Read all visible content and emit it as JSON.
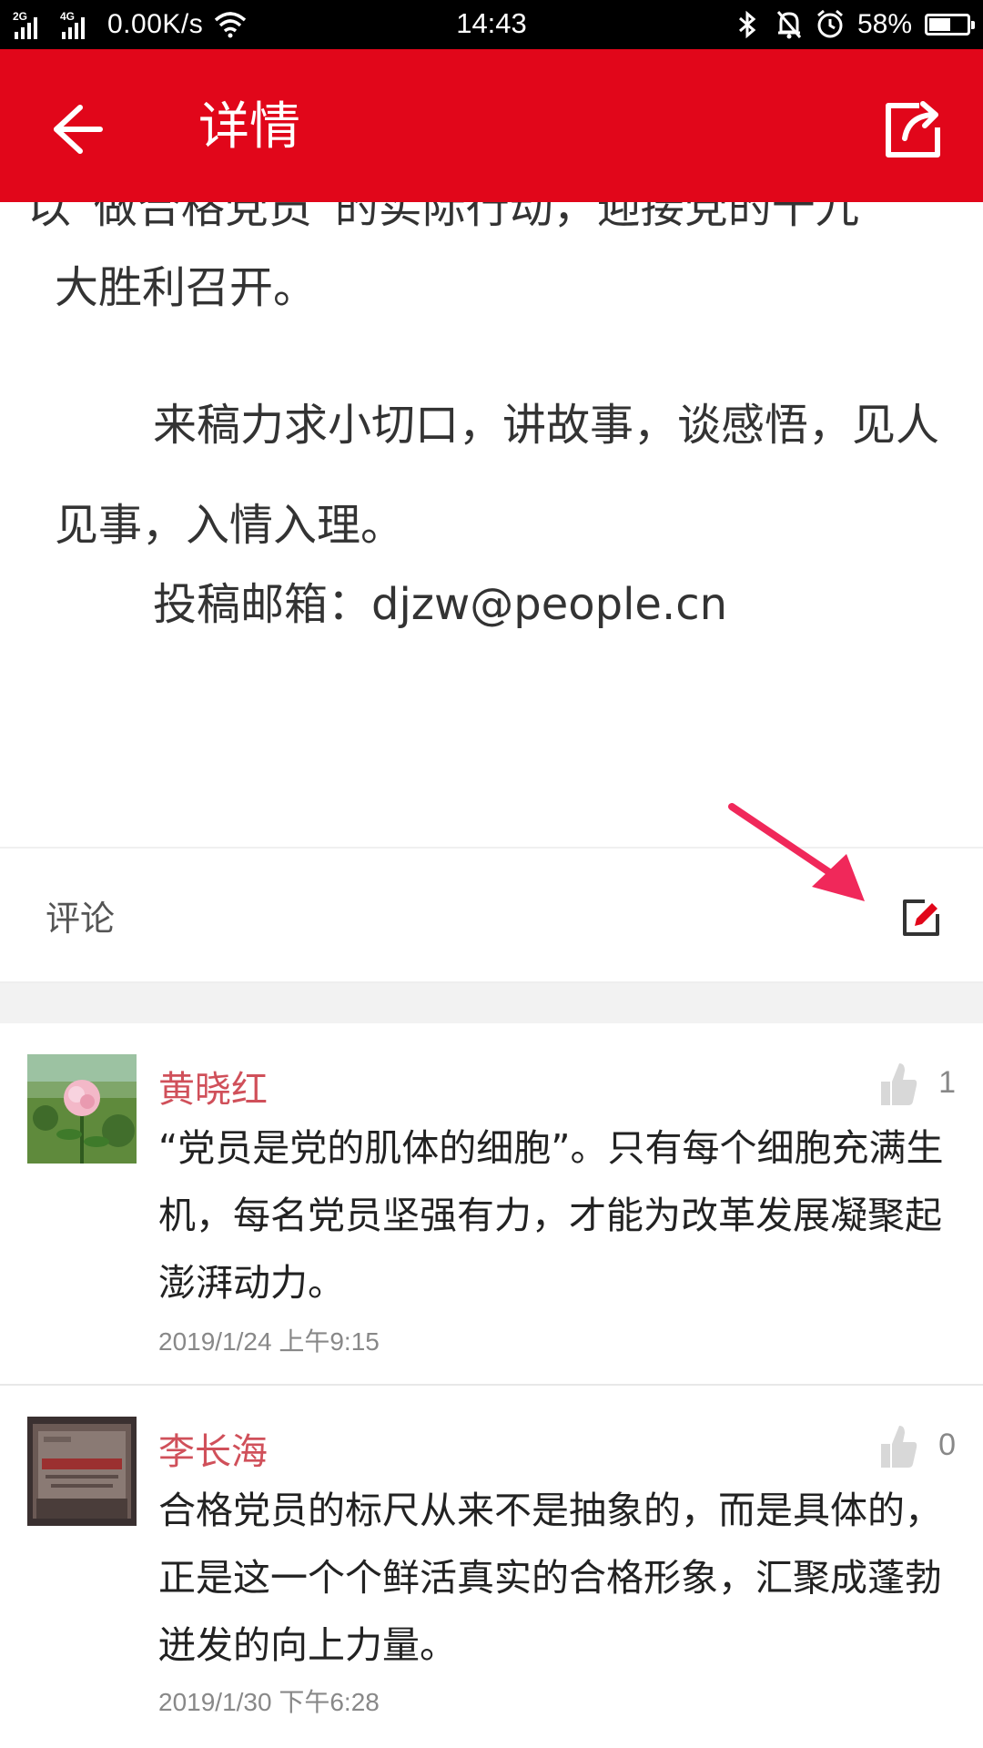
{
  "status_bar": {
    "net1": "2G",
    "net2": "4G",
    "speed": "0.00K/s",
    "time": "14:43",
    "battery_percent": "58%",
    "battery_level": 0.58
  },
  "app_bar": {
    "title": "详情",
    "back_icon": "arrow-left-icon",
    "share_icon": "share-icon",
    "color": "#e1061a"
  },
  "article": {
    "cut_line": "以“做合格党员”的实际行动，迎接党的十九",
    "p1": "大胜利召开。",
    "p2": "来稿力求小切口，讲故事，谈感悟，见人见事，入情入理。",
    "p3": "投稿邮箱：djzw@people.cn"
  },
  "comments_section": {
    "label": "评论",
    "edit_icon": "edit-icon",
    "accent": "#e1061a"
  },
  "comments": [
    {
      "name": "黄晓红",
      "likes": "1",
      "text": "“党员是党的肌体的细胞”。只有每个细胞充满生机，每名党员坚强有力，才能为改革发展凝聚起澎湃动力。",
      "time": "2019/1/24 上午9:15"
    },
    {
      "name": "李长海",
      "likes": "0",
      "text": "合格党员的标尺从来不是抽象的，而是具体的，正是这一个个鲜活真实的合格形象，汇聚成蓬勃迸发的向上力量。",
      "time": "2019/1/30 下午6:28"
    }
  ]
}
